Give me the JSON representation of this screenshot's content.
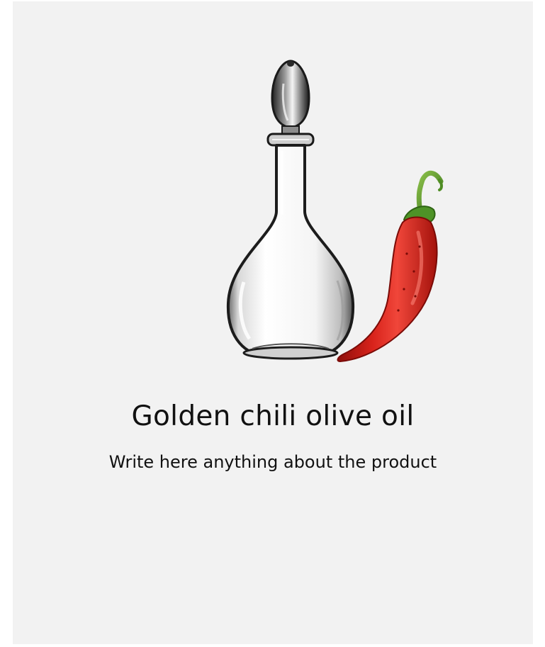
{
  "product": {
    "title": "Golden chili olive oil",
    "description": "Write here anything about the product",
    "image_icon": "decanter-and-chili-pepper-image"
  },
  "colors": {
    "card_background": "#f2f2f2",
    "text": "#111111",
    "pepper_red": "#d21f1a",
    "stem_green": "#5a9a2a"
  }
}
